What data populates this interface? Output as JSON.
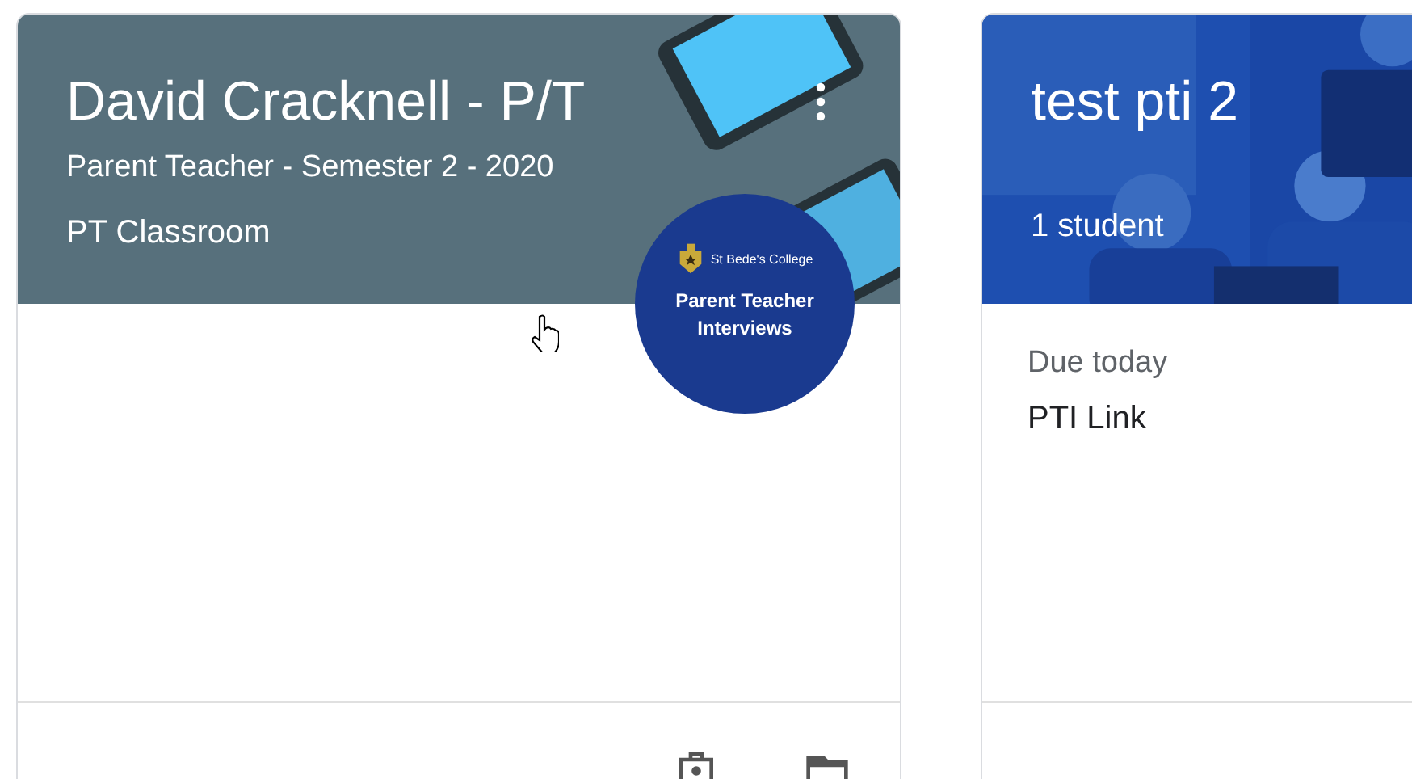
{
  "cards": [
    {
      "kind": "illustrated",
      "title": "David Cracknell - P/T",
      "subtitle": "Parent Teacher - Semester 2 - 2020",
      "section": "PT Classroom",
      "badge": {
        "school": "St Bede's College",
        "caption": "Parent Teacher Interviews"
      }
    },
    {
      "title": "test pti 2",
      "section": "1 student",
      "due_label": "Due today",
      "assignment": "PTI Link"
    }
  ]
}
